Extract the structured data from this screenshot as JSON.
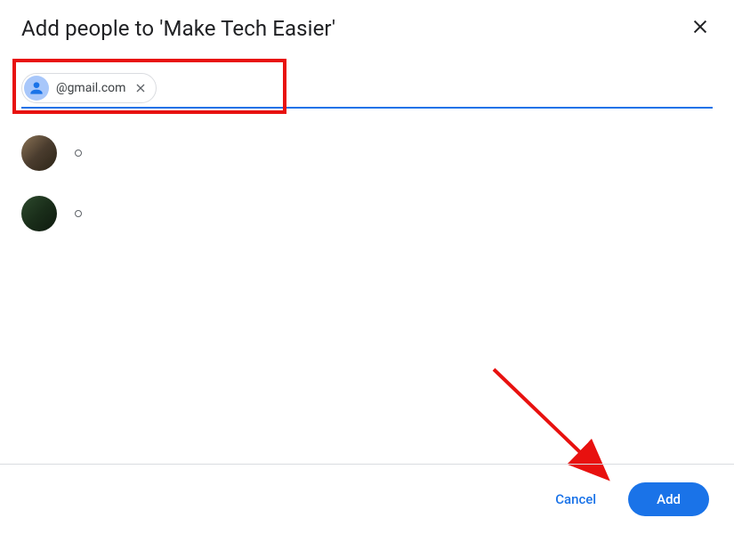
{
  "dialog": {
    "title": "Add people to 'Make Tech Easier'"
  },
  "input": {
    "chip_email": "@gmail.com",
    "placeholder": ""
  },
  "people": [
    {
      "id": "person-1"
    },
    {
      "id": "person-2"
    }
  ],
  "footer": {
    "cancel_label": "Cancel",
    "add_label": "Add"
  },
  "colors": {
    "primary": "#1a73e8",
    "annotation": "#e8110f"
  }
}
